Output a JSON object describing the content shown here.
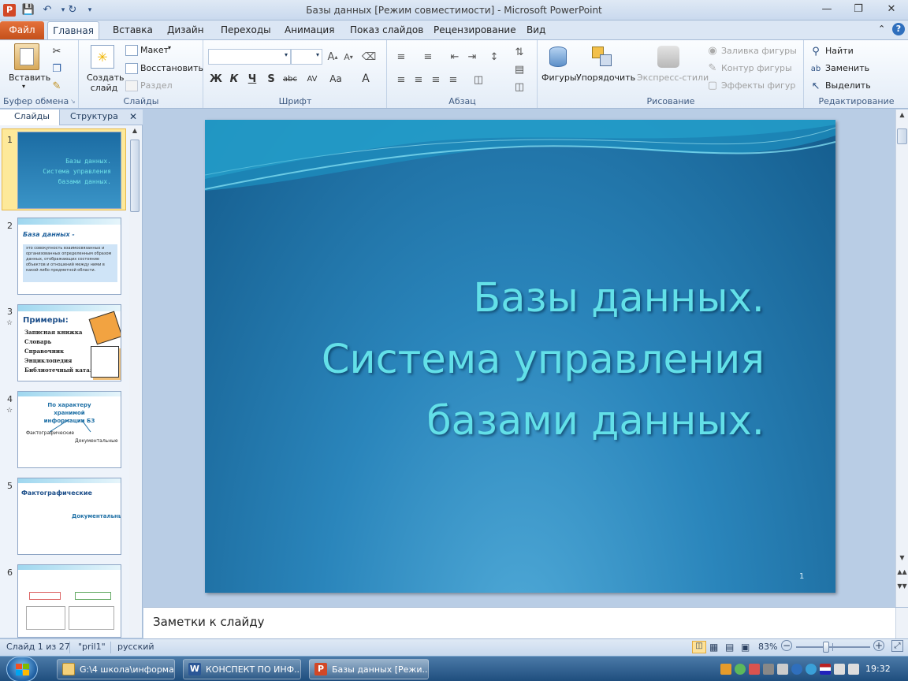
{
  "window": {
    "title": "Базы данных [Режим совместимости]  -  Microsoft PowerPoint"
  },
  "tabs": [
    {
      "label": "Файл"
    },
    {
      "label": "Главная"
    },
    {
      "label": "Вставка"
    },
    {
      "label": "Дизайн"
    },
    {
      "label": "Переходы"
    },
    {
      "label": "Анимация"
    },
    {
      "label": "Показ слайдов"
    },
    {
      "label": "Рецензирование"
    },
    {
      "label": "Вид"
    }
  ],
  "ribbon": {
    "clipboard": {
      "group": "Буфер обмена",
      "paste": "Вставить"
    },
    "slides": {
      "group": "Слайды",
      "new_slide": "Создать слайд",
      "layout": "Макет",
      "reset": "Восстановить",
      "section": "Раздел"
    },
    "font": {
      "group": "Шрифт",
      "bold": "Ж",
      "italic": "К",
      "underline": "Ч",
      "shadow": "S",
      "strike": "abc",
      "spacing": "AV",
      "case": "Аа"
    },
    "paragraph": {
      "group": "Абзац"
    },
    "drawing": {
      "group": "Рисование",
      "shapes": "Фигуры",
      "arrange": "Упорядочить",
      "quick_styles": "Экспресс-стили",
      "fill": "Заливка фигуры",
      "outline": "Контур фигуры",
      "effects": "Эффекты фигур"
    },
    "editing": {
      "group": "Редактирование",
      "find": "Найти",
      "replace": "Заменить",
      "select": "Выделить"
    }
  },
  "left_pane": {
    "tab_slides": "Слайды",
    "tab_outline": "Структура",
    "thumbnails": [
      {
        "num": "1",
        "lines": [
          "Базы данных.",
          "Система управления",
          "базами данных."
        ]
      },
      {
        "num": "2",
        "title": "База данных -",
        "body": "это совокупность взаимосвязанных и организованных определенным образом данных, отображающих состояние объектов и отношений между ними в какой-либо предметной области."
      },
      {
        "num": "3",
        "title": "Примеры:",
        "items": [
          "Записная книжка",
          "Словарь",
          "Справочник",
          "Энциклопедия",
          "Библиотечный каталог"
        ]
      },
      {
        "num": "4",
        "title": "По характеру хранимой информации БЗ",
        "left": "Фактографические",
        "right": "Документальные"
      },
      {
        "num": "5",
        "title": "Фактографические",
        "sub": "Документальные"
      },
      {
        "num": "6"
      }
    ]
  },
  "slide": {
    "title_lines": [
      "Базы данных.",
      "Система управления",
      "базами данных."
    ],
    "number": "1"
  },
  "notes": {
    "placeholder": "Заметки к слайду"
  },
  "status": {
    "slide_counter": "Слайд 1 из 27",
    "theme": "\"pril1\"",
    "language": "русский",
    "zoom": "83%",
    "zoom_level_percent": 83
  },
  "taskbar": {
    "items": [
      {
        "label": "G:\\4 школа\\информа..."
      },
      {
        "label": "КОНСПЕКТ ПО ИНФ..."
      },
      {
        "label": "Базы данных [Режи..."
      }
    ],
    "clock": "19:32"
  },
  "colors": {
    "ribbon_bg": "#e3ecf7",
    "file_tab": "#d4602a",
    "slide_title": "#63e0e8",
    "slide_bg": "#2a85bb"
  }
}
